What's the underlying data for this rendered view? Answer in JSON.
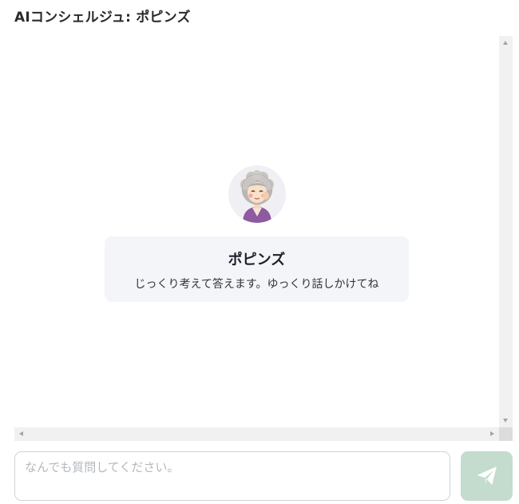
{
  "header": {
    "title": "AIコンシェルジュ: ポピンズ"
  },
  "concierge": {
    "name": "ポピンズ",
    "description": "じっくり考えて答えます。ゆっくり話しかけてね",
    "avatar_icon": "grandmother-avatar-icon"
  },
  "composer": {
    "placeholder": "なんでも質問してください。",
    "value": "",
    "send_icon": "paper-plane-icon"
  },
  "colors": {
    "send_button_bg": "#c3dccd",
    "card_bg": "#f4f5f9",
    "scrollbar_track": "#f1f1f1"
  }
}
